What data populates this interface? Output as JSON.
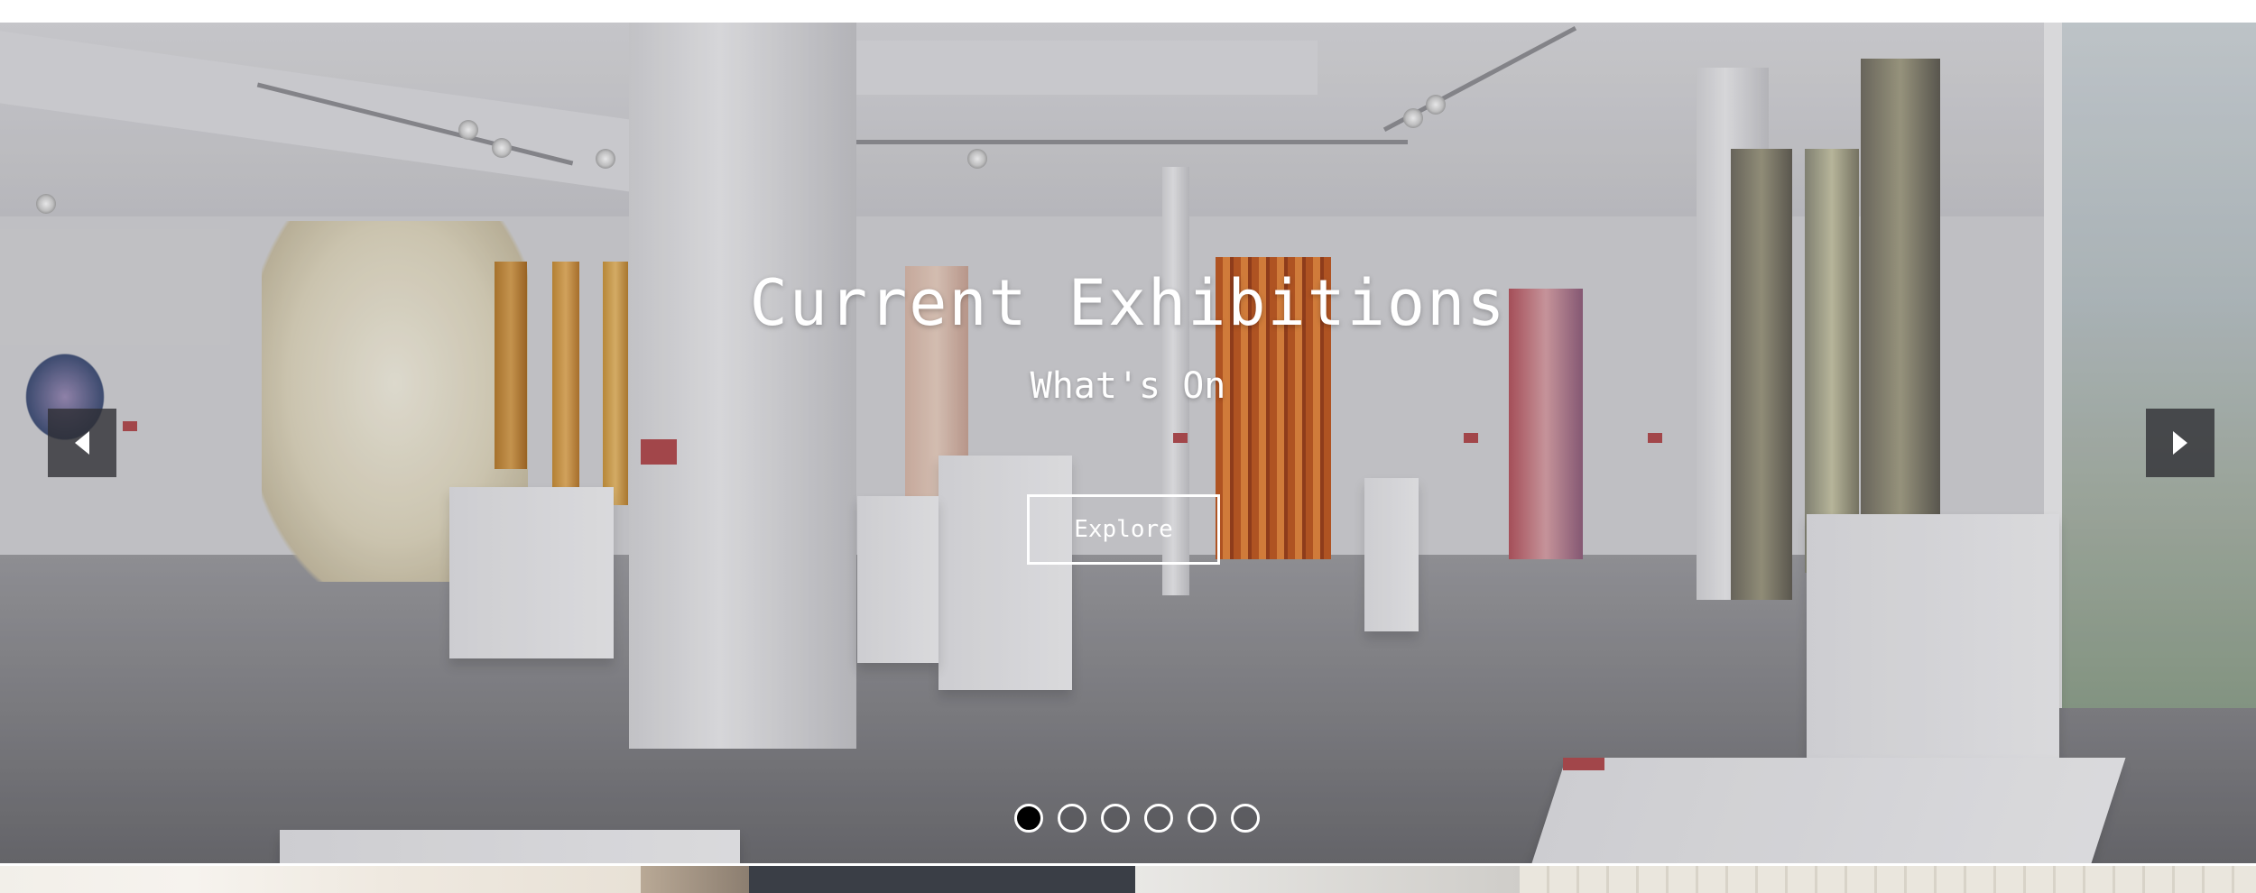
{
  "hero": {
    "title": "Current Exhibitions",
    "subtitle": "What's On",
    "explore_label": "Explore"
  },
  "carousel": {
    "prev_icon": "triangle-left-icon",
    "next_icon": "triangle-right-icon",
    "slide_count": 6,
    "active_index": 0
  },
  "colors": {
    "text": "#ffffff",
    "arrow_bg": "#2d2d32",
    "dot_active": "#000000"
  }
}
